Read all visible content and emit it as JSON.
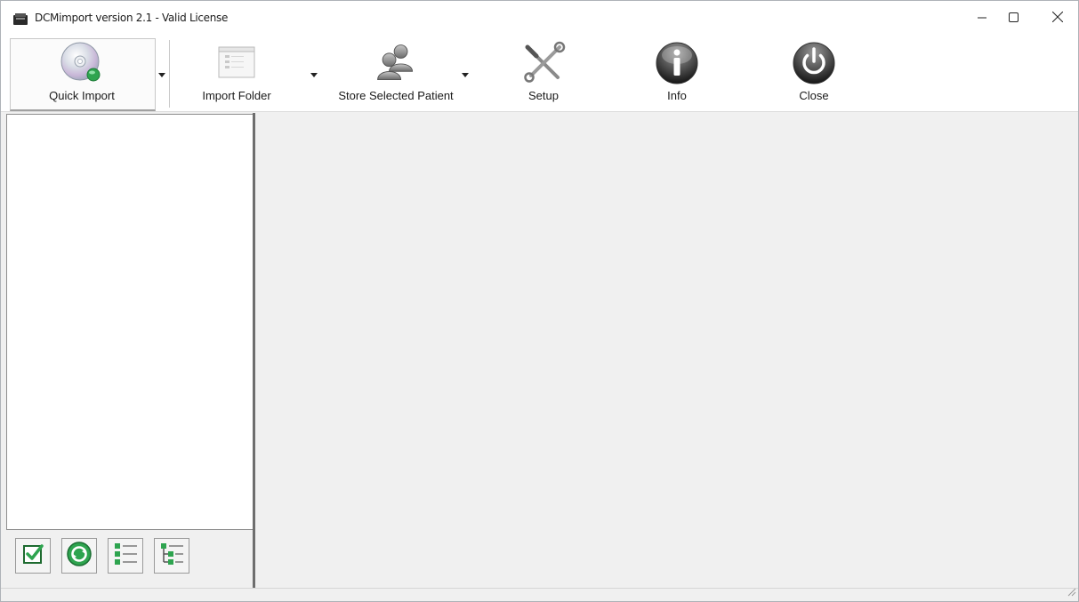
{
  "window": {
    "title": "DCMimport version 2.1 - Valid License",
    "controls": [
      "minimize-icon",
      "maximize-icon",
      "close-icon"
    ]
  },
  "toolbar": {
    "quick_import": "Quick Import",
    "import_folder": "Import Folder",
    "store_selected_patient": "Store Selected Patient",
    "setup": "Setup",
    "info": "Info",
    "close": "Close"
  },
  "bottom_tools": [
    {
      "icon": "checkbox-check-icon"
    },
    {
      "icon": "refresh-icon"
    },
    {
      "icon": "list-icon"
    },
    {
      "icon": "tree-icon"
    }
  ],
  "colors": {
    "accent_green": "#2ea44f",
    "toolbar_bg": "#ffffff",
    "panel_bg": "#f0f0f0"
  }
}
